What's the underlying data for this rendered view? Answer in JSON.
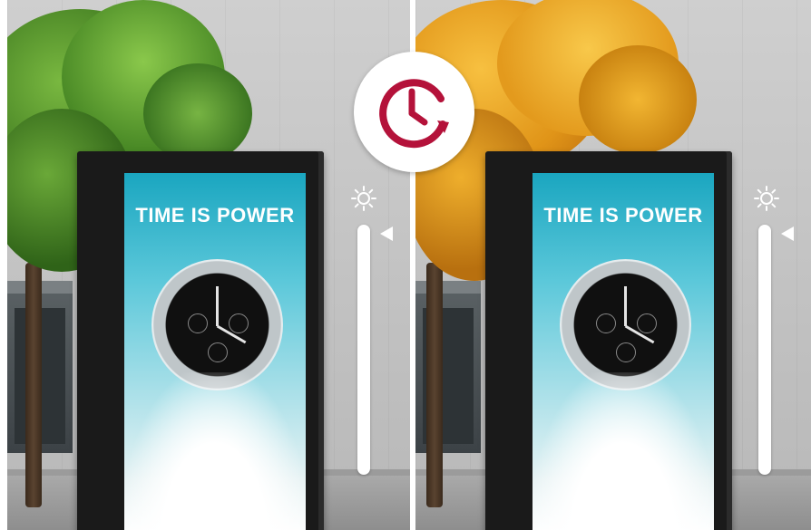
{
  "ad": {
    "headline": "TIME IS POWER"
  },
  "brightness": {
    "left_level": 0.94,
    "right_level": 0.94
  },
  "colors": {
    "accent": "#B4123A",
    "summer_foliage": "#4f8d2a",
    "autumn_foliage": "#e9a21a"
  },
  "icons": {
    "center": "clock-refresh-icon",
    "brightness": "sun-icon"
  }
}
